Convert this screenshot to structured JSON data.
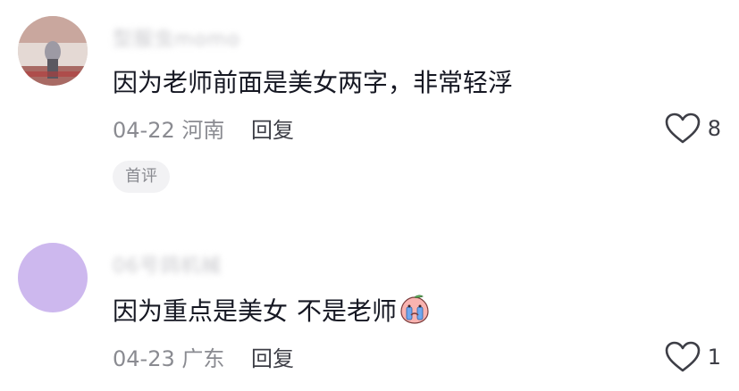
{
  "comments": [
    {
      "username": "型服虫momo",
      "text": "因为老师前面是美女两字，非常轻浮",
      "date": "04-22",
      "location": "河南",
      "reply_label": "回复",
      "likes": "8",
      "badge": "首评",
      "avatar_icon": "photo-avatar"
    },
    {
      "username": "06号鸽机械",
      "text_part1": "因为重点是美女",
      "text_part2": "不是老师",
      "emoji_icon": "crying-peach-emoji",
      "date": "04-23",
      "location": "广东",
      "reply_label": "回复",
      "likes": "1",
      "avatar_color": "#cdb8ee"
    }
  ],
  "colors": {
    "text_primary": "#161823",
    "text_secondary": "#8a8b91",
    "badge_bg": "#f2f2f4"
  }
}
